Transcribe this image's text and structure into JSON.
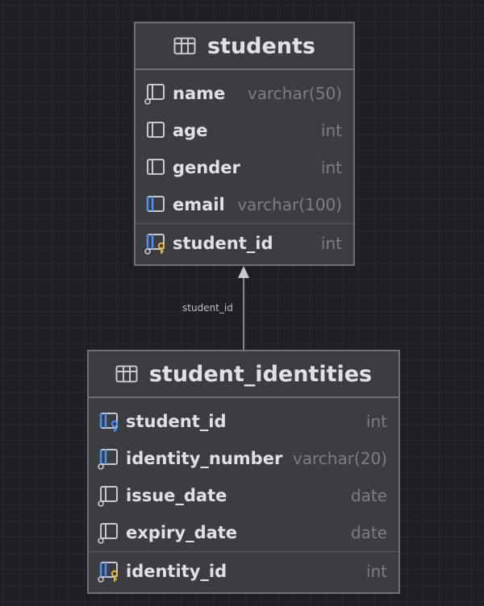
{
  "entities": [
    {
      "title": "students",
      "columns": [
        {
          "name": "name",
          "type": "varchar(50)",
          "icon": "column-icon"
        },
        {
          "name": "age",
          "type": "int",
          "icon": "column-icon"
        },
        {
          "name": "gender",
          "type": "int",
          "icon": "column-icon"
        },
        {
          "name": "email",
          "type": "varchar(100)",
          "icon": "column-icon"
        },
        {
          "name": "student_id",
          "type": "int",
          "icon": "primary-key-icon"
        }
      ]
    },
    {
      "title": "student_identities",
      "columns": [
        {
          "name": "student_id",
          "type": "int",
          "icon": "foreign-key-icon"
        },
        {
          "name": "identity_number",
          "type": "varchar(20)",
          "icon": "column-icon"
        },
        {
          "name": "issue_date",
          "type": "date",
          "icon": "column-icon"
        },
        {
          "name": "expiry_date",
          "type": "date",
          "icon": "column-icon"
        },
        {
          "name": "identity_id",
          "type": "int",
          "icon": "primary-key-icon"
        }
      ]
    }
  ],
  "relationship": {
    "label": "student_id",
    "from": "student_identities",
    "to": "students"
  },
  "colors": {
    "background": "#1e1f22",
    "entity_fill": "#3c3d41",
    "entity_border": "#6e7076",
    "text": "#dfe1e5",
    "type_text": "#7b7e85",
    "key_blue": "#4b8ef7",
    "key_gold": "#e0b33c"
  }
}
